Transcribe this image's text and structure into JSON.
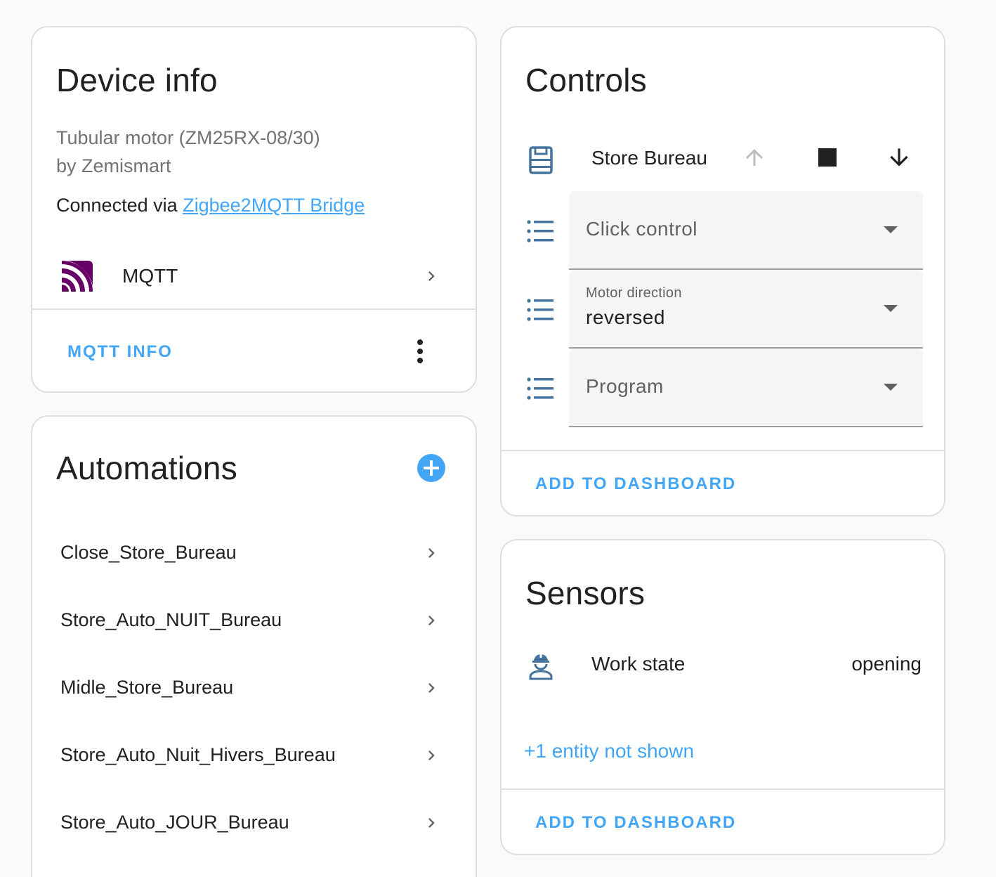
{
  "device_info": {
    "title": "Device info",
    "model": "Tubular motor (ZM25RX-08/30)",
    "manufacturer": "by Zemismart",
    "connected_prefix": "Connected via ",
    "connected_link": "Zigbee2MQTT Bridge",
    "integration_label": "MQTT",
    "integration_icon": "mqtt-icon",
    "action_label": "MQTT INFO",
    "brand_color": "#660066"
  },
  "automations": {
    "title": "Automations",
    "items": [
      "Close_Store_Bureau",
      "Store_Auto_NUIT_Bureau",
      "Midle_Store_Bureau",
      "Store_Auto_Nuit_Hivers_Bureau",
      "Store_Auto_JOUR_Bureau"
    ]
  },
  "controls": {
    "title": "Controls",
    "cover": {
      "name": "Store Bureau",
      "icon": "window-shutter-icon",
      "up_disabled": true
    },
    "selects": [
      {
        "placeholder": "Click control",
        "label": "",
        "value": ""
      },
      {
        "placeholder": "",
        "label": "Motor direction",
        "value": "reversed"
      },
      {
        "placeholder": "Program",
        "label": "",
        "value": ""
      }
    ],
    "action_label": "ADD TO DASHBOARD"
  },
  "sensors": {
    "title": "Sensors",
    "items": [
      {
        "name": "Work state",
        "value": "opening",
        "icon": "worker-icon"
      }
    ],
    "hidden_note": "+1 entity not shown",
    "action_label": "ADD TO DASHBOARD"
  },
  "colors": {
    "accent": "#42a5f5",
    "icon_state": "#44739e",
    "divider": "#e0e0e0"
  }
}
